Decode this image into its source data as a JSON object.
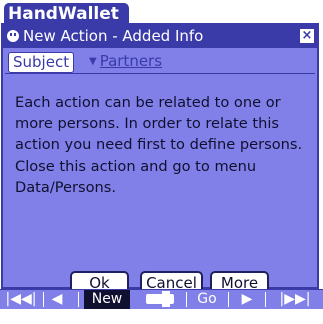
{
  "app": {
    "title": "HandWallet"
  },
  "dialog": {
    "title": "New Action - Added Info",
    "close_icon": "close-icon",
    "tabs": {
      "subject": "Subject",
      "partners": "Partners"
    },
    "message": "Each action can be related to one or more persons. In order to relate this action you need first to define persons. Close this action and go to menu Data/Persons.",
    "buttons": {
      "ok": "Ok",
      "cancel": "Cancel",
      "more": "More"
    }
  },
  "toolbar": {
    "first": "|◀◀|",
    "prev": "◀",
    "new": "New",
    "go": "Go",
    "next": "▶",
    "last": "|▶▶|"
  },
  "colors": {
    "accent": "#3a3aa8",
    "dialog_bg": "#8080e8"
  }
}
